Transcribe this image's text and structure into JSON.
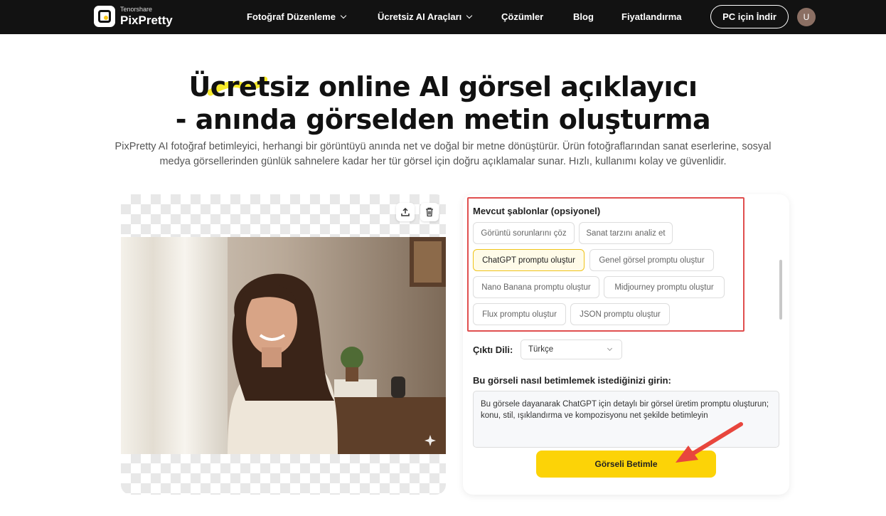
{
  "nav": {
    "logo_small": "Tenorshare",
    "logo_big": "PixPretty",
    "items": [
      "Fotoğraf Düzenleme",
      "Ücretsiz AI Araçları",
      "Çözümler",
      "Blog",
      "Fiyatlandırma"
    ],
    "download_label": "PC için İndir",
    "avatar_letter": "U"
  },
  "hero": {
    "title_line1": "Ücretsiz online AI görsel açıklayıcı",
    "title_line2": "- anında görselden metin oluşturma",
    "subtitle": "PixPretty AI fotoğraf betimleyici, herhangi bir görüntüyü anında net ve doğal bir metne dönüştürür. Ürün fotoğraflarından sanat eserlerine, sosyal medya görsellerinden günlük sahnelere kadar her tür görsel için doğru açıklamalar sunar. Hızlı, kullanımı kolay ve güvenlidir."
  },
  "templates": {
    "title": "Mevcut şablonlar (opsiyonel)",
    "chips": [
      "Görüntü sorunlarını çöz",
      "Sanat tarzını analiz et",
      "ChatGPT promptu oluştur",
      "Genel görsel promptu oluştur",
      "Nano Banana promptu oluştur",
      "Midjourney promptu oluştur",
      "Flux promptu oluştur",
      "JSON promptu oluştur"
    ],
    "selected": "ChatGPT promptu oluştur"
  },
  "output": {
    "label": "Çıktı Dili:",
    "language": "Türkçe"
  },
  "prompt": {
    "label": "Bu görseli nasıl betimlemek istediğinizi girin:",
    "value": "Bu görsele dayanarak ChatGPT için detaylı bir görsel üretim promptu oluşturun; konu, stil, ışıklandırma ve kompozisyonu net şekilde betimleyin"
  },
  "action": {
    "button_label": "Görseli Betimle"
  },
  "icons": [
    "upload-icon",
    "trash-icon",
    "sparkle-icon",
    "chevron-down-icon"
  ],
  "colors": {
    "accent": "#fcd307",
    "nav_bg": "#121212",
    "highlight_box": "#e04f4f"
  }
}
